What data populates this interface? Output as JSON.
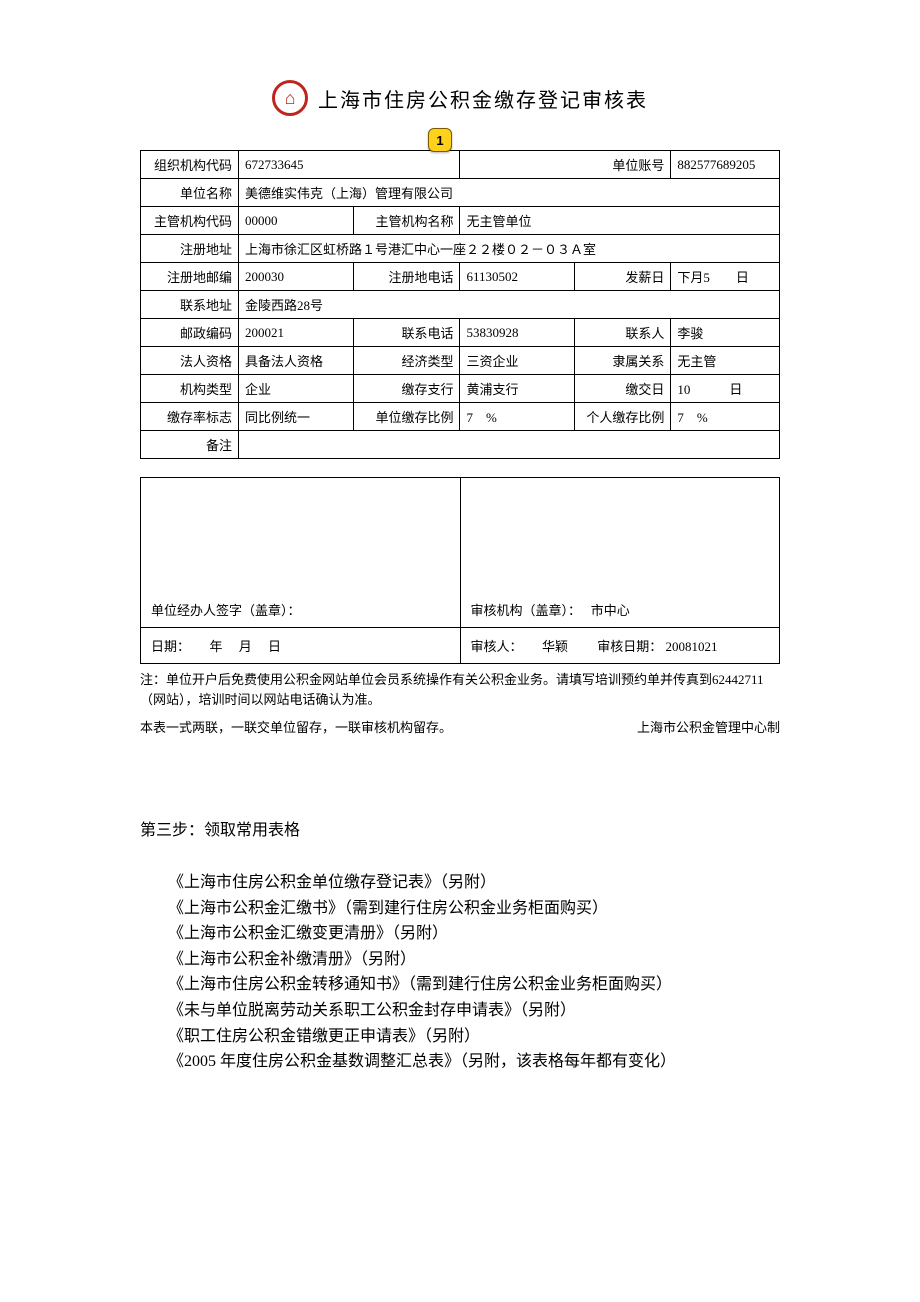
{
  "title": "上海市住房公积金缴存登记审核表",
  "balloon": "1",
  "form": {
    "org_code_lbl": "组织机构代码",
    "org_code": "672733645",
    "unit_acct_lbl": "单位账号",
    "unit_acct": "882577689205",
    "unit_name_lbl": "单位名称",
    "unit_name": "美德维实伟克（上海）管理有限公司",
    "supv_code_lbl": "主管机构代码",
    "supv_code": "00000",
    "supv_name_lbl": "主管机构名称",
    "supv_name": "无主管单位",
    "reg_addr_lbl": "注册地址",
    "reg_addr": "上海市徐汇区虹桥路１号港汇中心一座２２楼０２－０３Ａ室",
    "reg_zip_lbl": "注册地邮编",
    "reg_zip": "200030",
    "reg_tel_lbl": "注册地电话",
    "reg_tel": "61130502",
    "payday_lbl": "发薪日",
    "payday": "下月5　　日",
    "contact_addr_lbl": "联系地址",
    "contact_addr": "金陵西路28号",
    "post_zip_lbl": "邮政编码",
    "post_zip": "200021",
    "contact_tel_lbl": "联系电话",
    "contact_tel": "53830928",
    "contact_person_lbl": "联系人",
    "contact_person": "李骏",
    "legal_lbl": "法人资格",
    "legal": "具备法人资格",
    "econ_type_lbl": "经济类型",
    "econ_type": "三资企业",
    "sub_rel_lbl": "隶属关系",
    "sub_rel": "无主管",
    "org_type_lbl": "机构类型",
    "org_type": "企业",
    "branch_lbl": "缴存支行",
    "branch": "黄浦支行",
    "submit_day_lbl": "缴交日",
    "submit_day": "10　　　日",
    "rate_flag_lbl": "缴存率标志",
    "rate_flag": "同比例统一",
    "unit_rate_lbl": "单位缴存比例",
    "unit_rate": "7　%",
    "pers_rate_lbl": "个人缴存比例",
    "pers_rate": "7　%",
    "remark_lbl": "备注",
    "remark": ""
  },
  "sig": {
    "handler": "单位经办人签字（盖章）：",
    "auditor_org": "审核机构（盖章）：　 市中心",
    "date_left": "日期：　　年　 月　 日",
    "auditor": "审核人：　　华颖",
    "audit_date_lbl": "审核日期：",
    "audit_date": "20081021"
  },
  "notes": {
    "note1": "注：单位开户后免费使用公积金网站单位会员系统操作有关公积金业务。请填写培训预约单并传真到62442711（网站），培训时间以网站电话确认为准。",
    "note2a": "本表一式两联，一联交单位留存，一联审核机构留存。",
    "note2b": "上海市公积金管理中心制"
  },
  "step_heading": "第三步：领取常用表格",
  "list": [
    "《上海市住房公积金单位缴存登记表》（另附）",
    "《上海市公积金汇缴书》（需到建行住房公积金业务柜面购买）",
    "《上海市公积金汇缴变更清册》（另附）",
    "《上海市公积金补缴清册》（另附）",
    "《上海市住房公积金转移通知书》（需到建行住房公积金业务柜面购买）",
    "《未与单位脱离劳动关系职工公积金封存申请表》（另附）",
    "《职工住房公积金错缴更正申请表》（另附）",
    "《2005 年度住房公积金基数调整汇总表》（另附，该表格每年都有变化）"
  ]
}
